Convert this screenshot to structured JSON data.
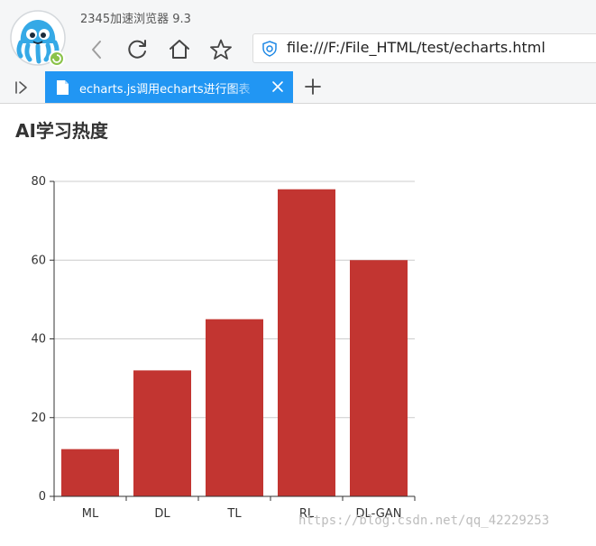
{
  "browser": {
    "app_title": "2345加速浏览器 9.3",
    "address_url": "file:///F:/File_HTML/test/echarts.html",
    "tab_title": "echarts.js调用echarts进行图表",
    "icons": {
      "logo": "octopus-logo-icon",
      "back": "back-arrow-icon",
      "refresh": "refresh-icon",
      "home": "home-icon",
      "bookmark": "star-icon",
      "security": "shield-icon",
      "sidebar": "sidebar-toggle-icon",
      "file": "file-icon",
      "close": "close-icon",
      "new_tab": "plus-icon"
    },
    "accent_color": "#2196f3"
  },
  "page": {
    "heading": "AI学习热度"
  },
  "chart_data": {
    "type": "bar",
    "title": "",
    "xlabel": "",
    "ylabel": "",
    "categories": [
      "ML",
      "DL",
      "TL",
      "RL",
      "DL-GAN"
    ],
    "values": [
      12,
      32,
      45,
      78,
      60
    ],
    "ylim": [
      0,
      80
    ],
    "yticks": [
      0,
      20,
      40,
      60,
      80
    ],
    "grid": true,
    "legend": "none",
    "bar_color": "#c23531"
  },
  "watermark": "https://blog.csdn.net/qq_42229253"
}
